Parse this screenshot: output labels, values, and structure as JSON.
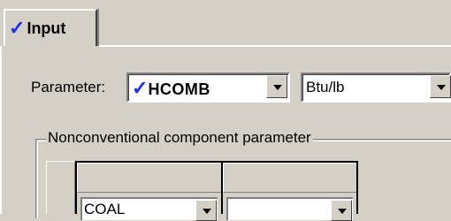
{
  "tabs": [
    {
      "label": "Input",
      "check_icon": "✓",
      "active": true
    }
  ],
  "parameter": {
    "label": "Parameter:",
    "value": "HCOMB",
    "check_icon": "✓",
    "units": "Btu/lb"
  },
  "nonconventional": {
    "title": "Nonconventional component parameter",
    "columns": [
      {
        "selected": "COAL"
      },
      {
        "selected": ""
      }
    ]
  },
  "colors": {
    "check_blue": "#1a2cff",
    "face": "#d4d0c8"
  }
}
